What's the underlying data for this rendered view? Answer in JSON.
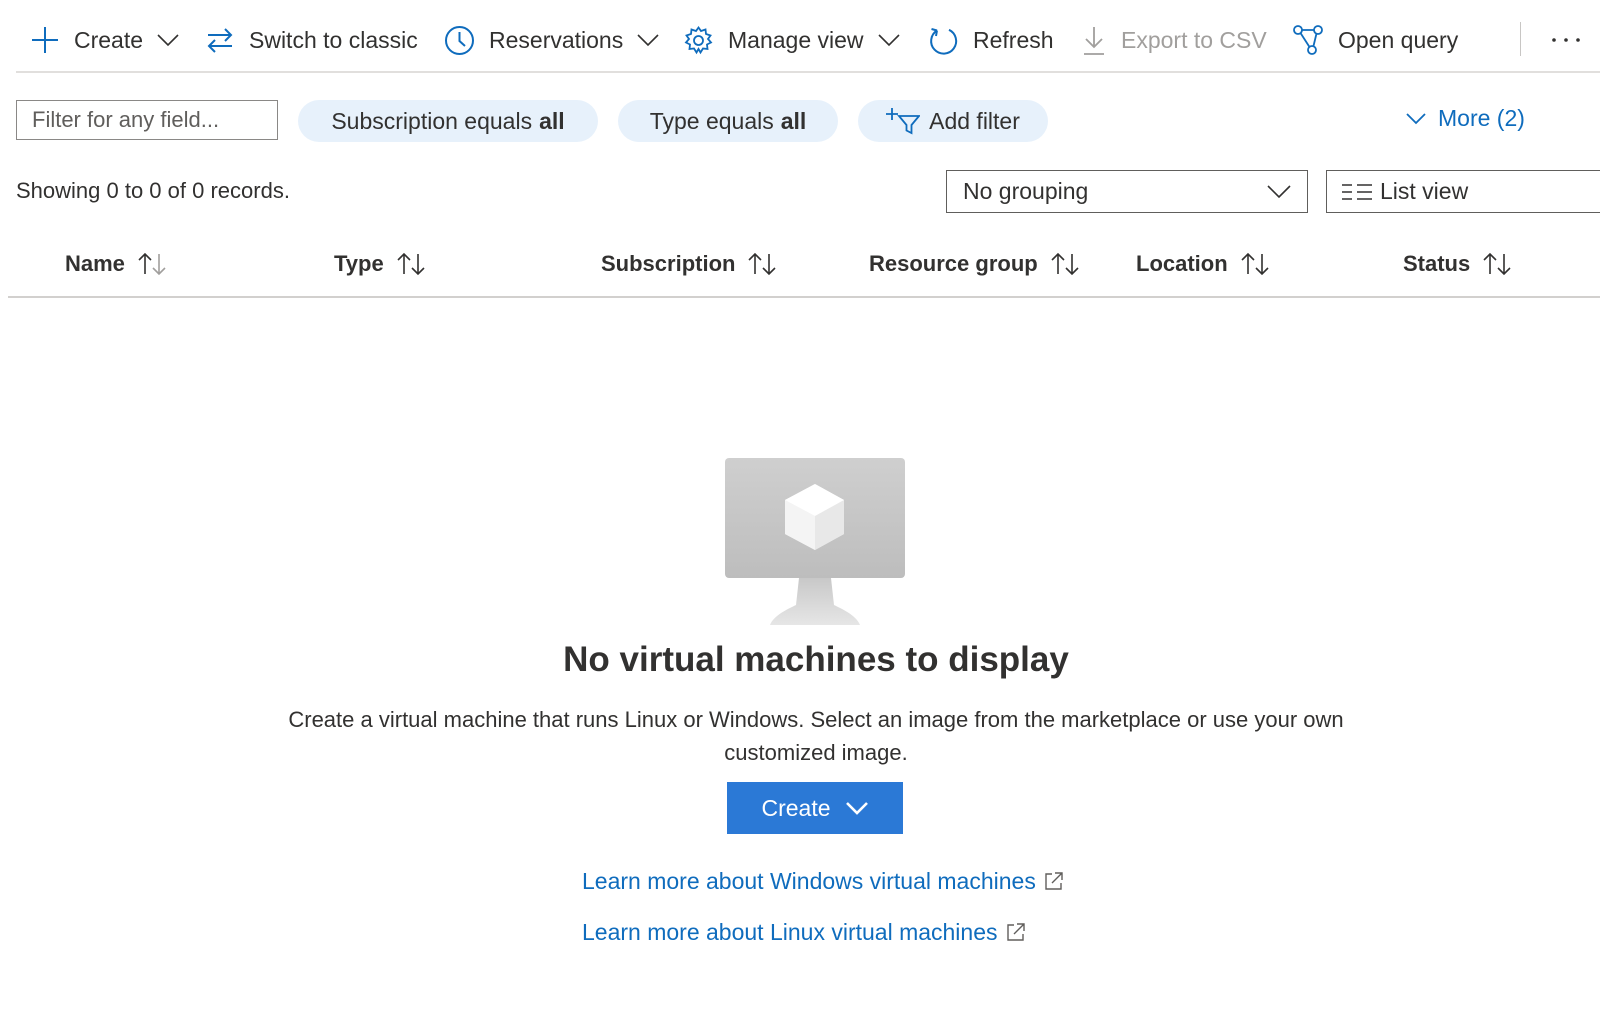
{
  "toolbar": {
    "create_label": "Create",
    "switch_label": "Switch to classic",
    "reservations_label": "Reservations",
    "manage_view_label": "Manage view",
    "refresh_label": "Refresh",
    "export_label": "Export to CSV",
    "open_query_label": "Open query",
    "more_icon": "ellipsis-icon",
    "accent_color": "#0f6cbd"
  },
  "filters": {
    "placeholder": "Filter for any field...",
    "subscription_prefix": "Subscription equals",
    "subscription_value": "all",
    "type_prefix": "Type equals",
    "type_value": "all",
    "add_filter_label": "Add filter",
    "more_label": "More (2)",
    "pill_color": "#e7f1fb"
  },
  "records": {
    "showing_text": "Showing 0 to 0 of 0 records.",
    "grouping_value": "No grouping",
    "view_value": "List view"
  },
  "table": {
    "columns": [
      "Name",
      "Type",
      "Subscription",
      "Resource group",
      "Location",
      "Status"
    ]
  },
  "empty_state": {
    "title": "No virtual machines to display",
    "description": "Create a virtual machine that runs Linux or Windows. Select an image from the marketplace or use your own customized image.",
    "create_label": "Create",
    "windows_link": "Learn more about Windows virtual machines",
    "linux_link": "Learn more about Linux virtual machines",
    "button_color": "#2b79d6"
  }
}
